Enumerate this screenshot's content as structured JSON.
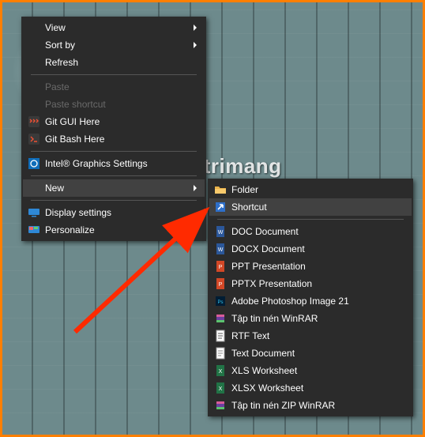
{
  "watermark_text": "uantrimang",
  "menu1": {
    "view": "View",
    "sort": "Sort by",
    "refresh": "Refresh",
    "paste": "Paste",
    "paste_shortcut": "Paste shortcut",
    "git_gui": "Git GUI Here",
    "git_bash": "Git Bash Here",
    "intel": "Intel® Graphics Settings",
    "new": "New",
    "display": "Display settings",
    "personalize": "Personalize"
  },
  "menu2": {
    "folder": "Folder",
    "shortcut": "Shortcut",
    "doc": "DOC Document",
    "docx": "DOCX Document",
    "ppt": "PPT Presentation",
    "pptx": "PPTX Presentation",
    "psd": "Adobe Photoshop Image 21",
    "rar": "Tập tin nén WinRAR",
    "rtf": "RTF Text",
    "txt": "Text Document",
    "xls": "XLS Worksheet",
    "xlsx": "XLSX Worksheet",
    "zip": "Tập tin nén ZIP WinRAR"
  }
}
